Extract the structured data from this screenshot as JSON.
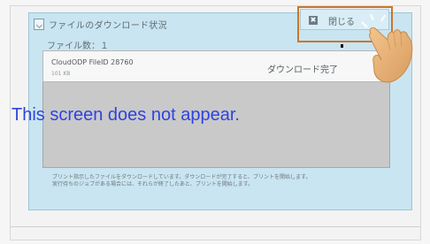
{
  "dialog": {
    "title": "ファイルのダウンロード状況",
    "close_label": "閉じる",
    "close_icon_glyph": "✖",
    "file_count_text": "ファイル数：１",
    "files": [
      {
        "name": "CloudODP FileID 28760",
        "size": "101 KB",
        "status": "ダウンロード完了"
      }
    ],
    "message_lines": [
      "プリント指示したファイルをダウンロードしています。ダウンロードが完了すると、プリントを開始します。",
      "実行待ちのジョブがある場合には、それらが終了したあと、プリントを開始します。"
    ]
  },
  "overlay": {
    "note": "This screen does not appear."
  },
  "colors": {
    "accent_outline": "#c9772b",
    "dialog_bg": "#c9e5f1",
    "overlay_text": "#2f43df"
  },
  "icons": {
    "title_icon": "download-status-icon",
    "close_icon": "close-icon",
    "hand_icon": "pointing-hand-icon"
  }
}
